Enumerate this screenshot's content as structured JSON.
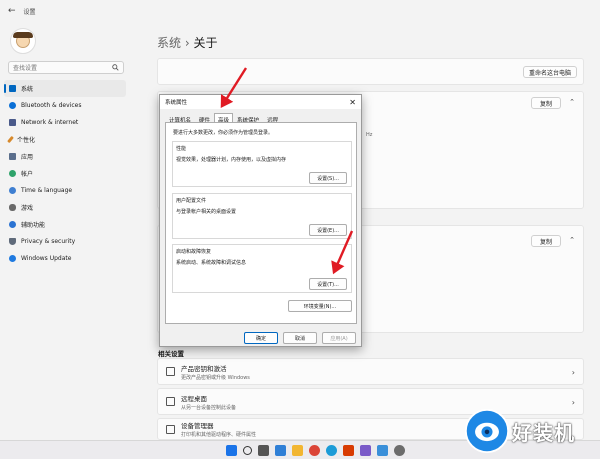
{
  "window": {
    "title": "设置",
    "back_glyph": "←"
  },
  "sidebar": {
    "search_placeholder": "查找设置",
    "items": [
      {
        "label": "系统",
        "icon": "monitor-icon",
        "color": "#0067c0",
        "active": true
      },
      {
        "label": "Bluetooth & devices",
        "icon": "bluetooth-icon",
        "color": "#0a6fd6"
      },
      {
        "label": "Network & internet",
        "icon": "wifi-icon",
        "color": "#4a5a8a"
      },
      {
        "label": "个性化",
        "icon": "brush-icon",
        "color": "#d7892b"
      },
      {
        "label": "应用",
        "icon": "apps-icon",
        "color": "#5a6e8c"
      },
      {
        "label": "帐户",
        "icon": "account-icon",
        "color": "#2fa36b"
      },
      {
        "label": "Time & language",
        "icon": "globe-clock-icon",
        "color": "#3f7fd1"
      },
      {
        "label": "游戏",
        "icon": "gamepad-icon",
        "color": "#6a6a6a"
      },
      {
        "label": "辅助功能",
        "icon": "accessibility-icon",
        "color": "#2b73d2"
      },
      {
        "label": "Privacy & security",
        "icon": "shield-icon",
        "color": "#5f6a7a"
      },
      {
        "label": "Windows Update",
        "icon": "update-icon",
        "color": "#1f7ae0"
      }
    ]
  },
  "main": {
    "breadcrumb_parent": "系统",
    "breadcrumb_sep": "›",
    "breadcrumb_current": "关于",
    "rename_button": "重命名这台电脑",
    "copy_button_1": "复制",
    "copy_button_2": "复制",
    "partial_hz": "Hz",
    "related_heading": "相关设置",
    "related": [
      {
        "title": "产品密钥和激活",
        "sub": "更改产品密钥或升级 Windows",
        "icon": "key-icon"
      },
      {
        "title": "远程桌面",
        "sub": "从另一台设备控制此设备",
        "icon": "remote-icon"
      },
      {
        "title": "设备管理器",
        "sub": "打印机和其他驱动程序、硬件属性",
        "icon": "device-manager-icon"
      }
    ]
  },
  "dialog": {
    "title": "系统属性",
    "close": "✕",
    "tabs": [
      "计算机名",
      "硬件",
      "高级",
      "系统保护",
      "远程"
    ],
    "active_tab": 2,
    "admin_note": "要进行大多数更改，你必须作为管理员登录。",
    "groups": [
      {
        "title": "性能",
        "desc": "视觉效果，处理器计划，内存使用，以及虚拟内存",
        "button": "设置(S)..."
      },
      {
        "title": "用户配置文件",
        "desc": "与登录帐户相关的桌面设置",
        "button": "设置(E)..."
      },
      {
        "title": "启动和故障恢复",
        "desc": "系统启动、系统故障和调试信息",
        "button": "设置(T)..."
      }
    ],
    "env_button": "环境变量(N)...",
    "ok": "确定",
    "cancel": "取消",
    "apply": "应用(A)"
  },
  "taskbar": {
    "icons": [
      {
        "name": "start-icon",
        "color": "#1a73e8"
      },
      {
        "name": "search-icon",
        "color": "#333333"
      },
      {
        "name": "task-view-icon",
        "color": "#555555"
      },
      {
        "name": "widgets-icon",
        "color": "#2f7fd6"
      },
      {
        "name": "explorer-icon",
        "color": "#f2b632"
      },
      {
        "name": "chrome-icon",
        "color": "#db4437"
      },
      {
        "name": "edge-icon",
        "color": "#1c9bd7"
      },
      {
        "name": "office-icon",
        "color": "#d83b01"
      },
      {
        "name": "app-icon",
        "color": "#7a5ac8"
      },
      {
        "name": "store-icon",
        "color": "#3a8fd9"
      },
      {
        "name": "settings-icon",
        "color": "#6c6c6c"
      }
    ]
  },
  "watermark": {
    "text": "好装机"
  },
  "colors": {
    "accent": "#0067c0",
    "arrow": "#e01b24"
  }
}
